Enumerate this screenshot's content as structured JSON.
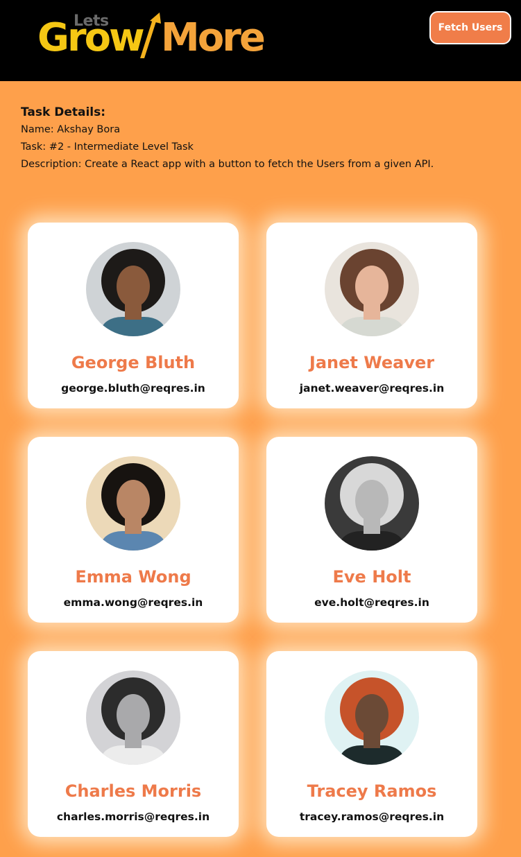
{
  "header": {
    "logo": {
      "lets": "Lets",
      "grow": "Grow",
      "more": "More"
    },
    "fetch_button_label": "Fetch Users"
  },
  "task": {
    "heading": "Task Details:",
    "name": "Name: Akshay Bora",
    "task": "Task: #2 - Intermediate Level Task",
    "description": "Description: Create a React app with a button to fetch the Users from a given API."
  },
  "users": [
    {
      "name": "George Bluth",
      "email": "george.bluth@reqres.in",
      "avatar_bg": "#cfd3d6",
      "hair": "#1d1a18",
      "skin": "#8a5a3c",
      "shirt": "#3d6f86"
    },
    {
      "name": "Janet Weaver",
      "email": "janet.weaver@reqres.in",
      "avatar_bg": "#e9e4dd",
      "hair": "#6a4330",
      "skin": "#e6b59a",
      "shirt": "#d6d9d2"
    },
    {
      "name": "Emma Wong",
      "email": "emma.wong@reqres.in",
      "avatar_bg": "#ecd9b8",
      "hair": "#171310",
      "skin": "#b98665",
      "shirt": "#5b86b0"
    },
    {
      "name": "Eve Holt",
      "email": "eve.holt@reqres.in",
      "avatar_bg": "#3a3a3a",
      "hair": "#d8d8d8",
      "skin": "#b8b8b8",
      "shirt": "#222222"
    },
    {
      "name": "Charles Morris",
      "email": "charles.morris@reqres.in",
      "avatar_bg": "#d3d3d6",
      "hair": "#2c2c2c",
      "skin": "#a9a9ab",
      "shirt": "#ececec"
    },
    {
      "name": "Tracey Ramos",
      "email": "tracey.ramos@reqres.in",
      "avatar_bg": "#dff2f3",
      "hair": "#c6532a",
      "skin": "#6b4a36",
      "shirt": "#1d2b2c"
    }
  ],
  "colors": {
    "header_bg": "#000000",
    "page_bg": "#fea04b",
    "accent": "#ee7a4a",
    "button_bg": "#f07d49"
  }
}
